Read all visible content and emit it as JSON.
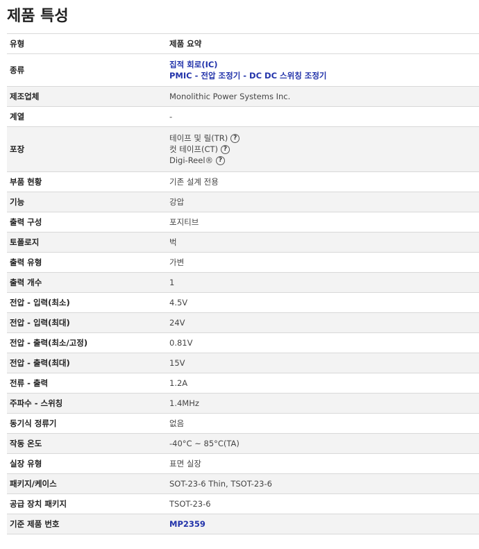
{
  "title": "제품 특성",
  "header": {
    "type": "유형",
    "summary": "제품 요약"
  },
  "rows": [
    {
      "label": "종류",
      "lines": [
        "집적 회로(IC)",
        "PMIC - 전압 조정기 - DC DC 스위칭 조정기"
      ]
    },
    {
      "label": "제조업체",
      "value": "Monolithic Power Systems Inc."
    },
    {
      "label": "계열",
      "value": "-"
    },
    {
      "label": "포장",
      "packaging": [
        "테이프 및 릴(TR)",
        "컷 테이프(CT)",
        "Digi-Reel®"
      ]
    },
    {
      "label": "부품 현황",
      "value": "기존 설계 전용"
    },
    {
      "label": "기능",
      "value": "강압"
    },
    {
      "label": "출력 구성",
      "value": "포지티브"
    },
    {
      "label": "토폴로지",
      "value": "벅"
    },
    {
      "label": "출력 유형",
      "value": "가변"
    },
    {
      "label": "출력 개수",
      "value": "1"
    },
    {
      "label": "전압 - 입력(최소)",
      "value": "4.5V"
    },
    {
      "label": "전압 - 입력(최대)",
      "value": "24V"
    },
    {
      "label": "전압 - 출력(최소/고정)",
      "value": "0.81V"
    },
    {
      "label": "전압 - 출력(최대)",
      "value": "15V"
    },
    {
      "label": "전류 - 출력",
      "value": "1.2A"
    },
    {
      "label": "주파수 - 스위칭",
      "value": "1.4MHz"
    },
    {
      "label": "동기식 정류기",
      "value": "없음"
    },
    {
      "label": "작동 온도",
      "value": "-40°C ~ 85°C(TA)"
    },
    {
      "label": "실장 유형",
      "value": "표면 실장"
    },
    {
      "label": "패키지/케이스",
      "value": "SOT-23-6 Thin, TSOT-23-6"
    },
    {
      "label": "공급 장치 패키지",
      "value": "TSOT-23-6"
    },
    {
      "label": "기준 제품 번호",
      "value": "MP2359"
    }
  ],
  "help_icon_glyph": "?",
  "link_color": "#2233aa"
}
